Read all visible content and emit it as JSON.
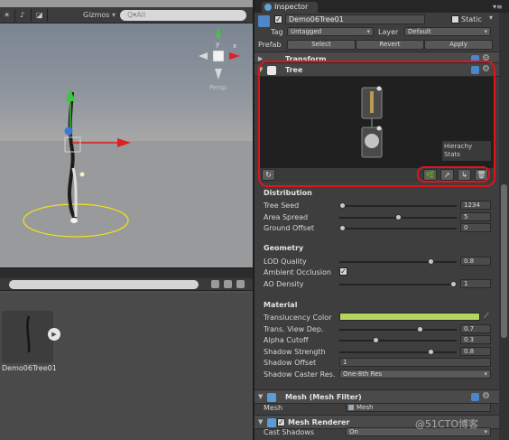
{
  "scene": {
    "shading_label": "☀",
    "audio_label": "♪",
    "effects_label": "◪",
    "gizmos_label": "Gizmos",
    "search_placeholder": "Q▾All",
    "persp_label": "Persp",
    "gizmo_axis_x": "x",
    "gizmo_axis_y": "y"
  },
  "project": {
    "asset_name": "Demo06Tree01"
  },
  "inspector": {
    "tab_label": "Inspector",
    "menu_glyph": "▾≡",
    "object_name": "Demo06Tree01",
    "active_checked": true,
    "static_label": "Static",
    "tag_label": "Tag",
    "tag_value": "Untagged",
    "layer_label": "Layer",
    "layer_value": "Default",
    "prefab_label": "Prefab",
    "prefab_buttons": [
      "Select",
      "Revert",
      "Apply"
    ],
    "transform_title": "Transform",
    "tree_title": "Tree",
    "hierarchy_stats_label": "Hierachy\nStats",
    "refresh_glyph": "↻",
    "tree_tool_glyphs": [
      "🌿",
      "➚",
      "↳",
      "🗑"
    ],
    "distribution": {
      "title": "Distribution",
      "rows": [
        {
          "label": "Tree Seed",
          "value": "1234",
          "fraction": 0.0
        },
        {
          "label": "Area Spread",
          "value": "5",
          "fraction": 0.5
        },
        {
          "label": "Ground Offset",
          "value": "0",
          "fraction": 0.0
        }
      ]
    },
    "geometry": {
      "title": "Geometry",
      "lod_quality": {
        "label": "LOD Quality",
        "value": "0.8",
        "fraction": 0.8
      },
      "ambient_occlusion": {
        "label": "Ambient Occlusion",
        "checked": true
      },
      "ao_density": {
        "label": "AO Density",
        "value": "1",
        "fraction": 1.0
      }
    },
    "material": {
      "title": "Material",
      "translucency_color": {
        "label": "Translucency Color",
        "color": "#b5d55e"
      },
      "trans_view_dep": {
        "label": "Trans. View Dep.",
        "value": "0.7",
        "fraction": 0.7
      },
      "alpha_cutoff": {
        "label": "Alpha Cutoff",
        "value": "0.3",
        "fraction": 0.3
      },
      "shadow_strength": {
        "label": "Shadow Strength",
        "value": "0.8",
        "fraction": 0.8
      },
      "shadow_offset": {
        "label": "Shadow Offset",
        "value": "1"
      },
      "shadow_caster_res": {
        "label": "Shadow Caster Res.",
        "value": "One-8th Res"
      }
    },
    "mesh_filter": {
      "title": "Mesh (Mesh Filter)",
      "mesh_label": "Mesh",
      "mesh_value": "Mesh"
    },
    "mesh_renderer": {
      "title": "Mesh Renderer",
      "cast_shadows_label": "Cast Shadows",
      "cast_shadows_value": "On"
    }
  },
  "watermark": "@51CTO博客",
  "colors": {
    "selection_red": "#e0141b",
    "axis_red": "#e02020",
    "axis_green": "#3ec83e",
    "axis_blue": "#3b78d8",
    "ground_circle": "#f0e21b"
  }
}
